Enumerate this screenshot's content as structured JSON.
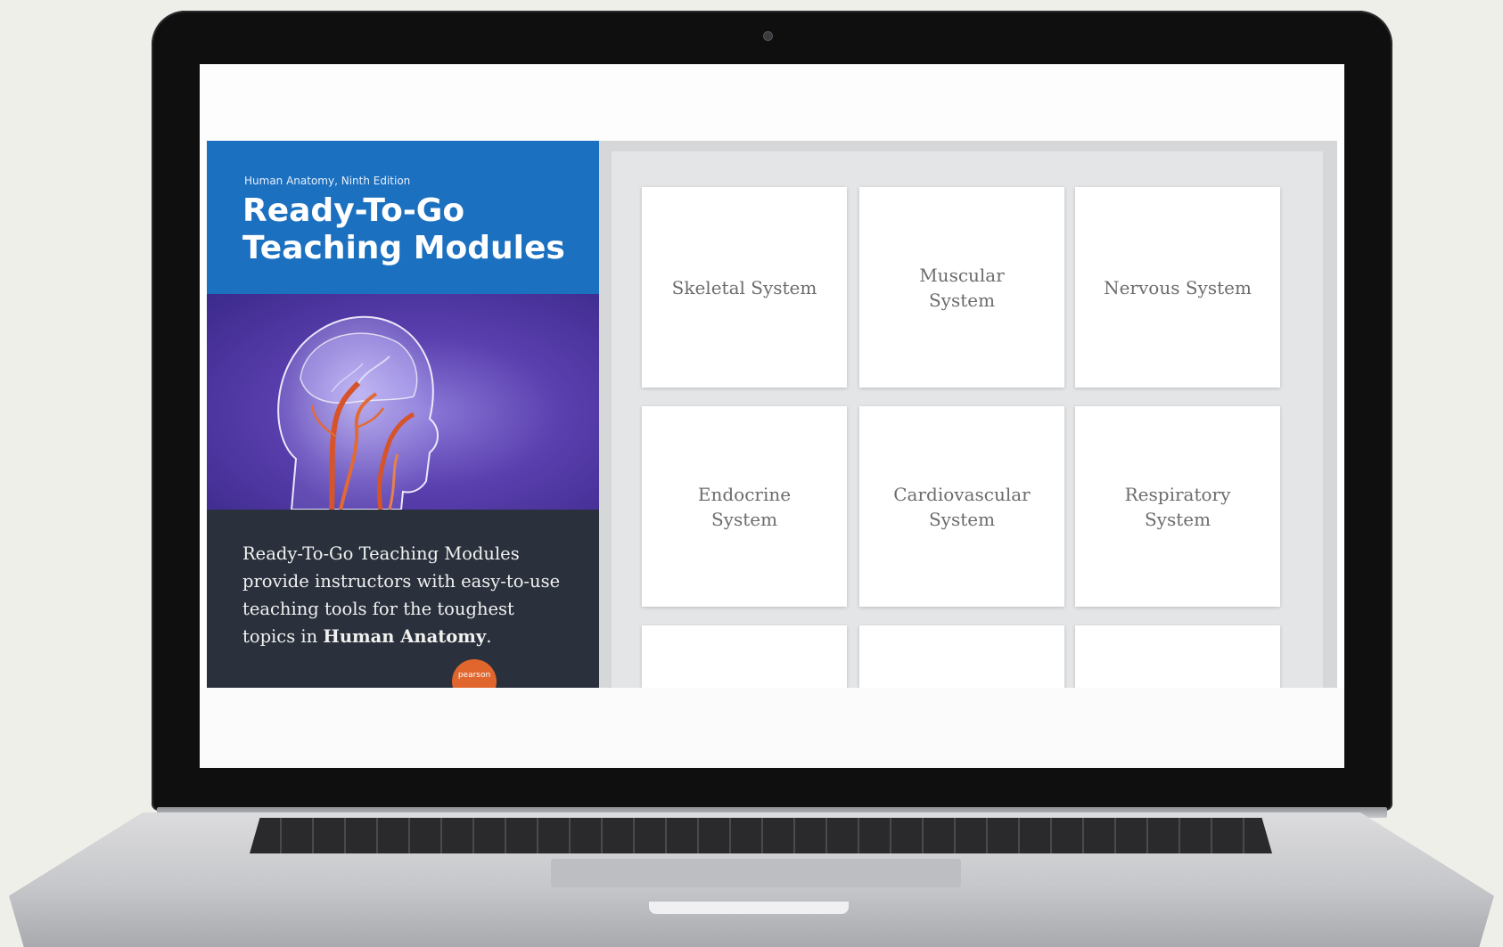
{
  "cover": {
    "edition": "Human Anatomy, Ninth Edition",
    "title_line1": "Ready-To-Go",
    "title_line2": "Teaching Modules",
    "description": "Ready-To-Go Teaching Modules provide instructors with easy-to-use teaching tools for the toughest topics in",
    "description_bold": "Human Anatomy",
    "description_end": ".",
    "badge": "pearson"
  },
  "modules": [
    {
      "label": "Skeletal System"
    },
    {
      "label": "Muscular System"
    },
    {
      "label": "Nervous System"
    },
    {
      "label": "Endocrine System"
    },
    {
      "label": "Cardiovascular System"
    },
    {
      "label": "Respiratory System"
    },
    {
      "label": ""
    },
    {
      "label": ""
    },
    {
      "label": ""
    }
  ],
  "colors": {
    "cover_header": "#1c70c0",
    "cover_art": "#5a3fae",
    "cover_footer": "#2a313d",
    "module_text": "#6c6c6c"
  },
  "icons": {
    "camera": "camera-dot",
    "cover_art": "head-vascular-illustration"
  }
}
